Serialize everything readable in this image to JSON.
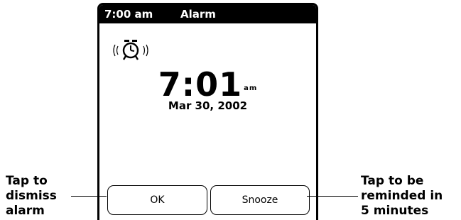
{
  "header": {
    "time": "7:00 am",
    "title": "Alarm"
  },
  "alarm": {
    "icon": "alarm-clock-icon",
    "time": "7:01",
    "ampm": "am",
    "date": "Mar 30, 2002"
  },
  "buttons": {
    "ok_label": "OK",
    "snooze_label": "Snooze"
  },
  "callouts": {
    "left": [
      "Tap to",
      "dismiss",
      "alarm"
    ],
    "right": [
      "Tap to be",
      "reminded in",
      "5 minutes"
    ]
  }
}
